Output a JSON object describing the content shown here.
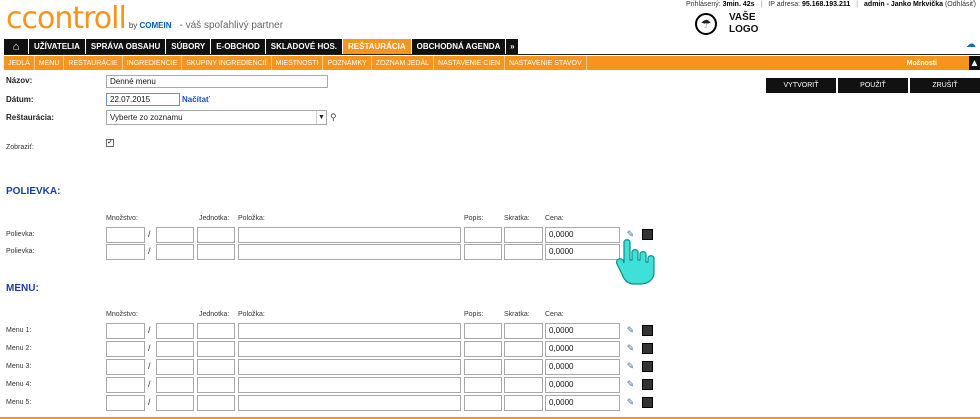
{
  "header": {
    "logo_main": "ccontroll",
    "logo_by": "by",
    "logo_company": "COMEIN",
    "tagline": "- váš spoľahlivý partner",
    "login_label": "Prihlásený:",
    "login_time": "3min. 42s",
    "ip_label": "IP adresa:",
    "ip_value": "95.168.193.211",
    "user": "admin - Janko Mrkvička",
    "logout": "(Odhlásiť)",
    "client_logo_line1": "VAŠE",
    "client_logo_line2": "LOGO"
  },
  "mainnav": {
    "items": [
      "UŽÍVATELIA",
      "SPRÁVA OBSAHU",
      "SÚBORY",
      "E-OBCHOD",
      "SKLADOVÉ HOS.",
      "REŠTAURÁCIA",
      "OBCHODNÁ AGENDA"
    ],
    "active_index": 5,
    "more": "»"
  },
  "subnav": {
    "items": [
      "Jedlá",
      "Menu",
      "Reštaurácie",
      "Ingrediencie",
      "Skupiny ingrediencií",
      "Miestnosti",
      "Poznámky",
      "Zoznam jedál",
      "Nastavenie cien",
      "Nastavenie stavov"
    ],
    "options": "Možnosti"
  },
  "actions": {
    "create": "VYTVORIŤ",
    "use": "POUŽIŤ",
    "cancel": "ZRUŠIŤ"
  },
  "form": {
    "name_label": "Názov:",
    "name_value": "Denné menu",
    "date_label": "Dátum:",
    "date_value": "22.07.2015",
    "load_label": "Načítať",
    "restaurant_label": "Reštaurácia:",
    "restaurant_value": "Vyberte zo zoznamu",
    "show_label": "Zobraziť:",
    "show_checked": true
  },
  "columns": {
    "quantity": "Množstvo:",
    "unit": "Jednotka:",
    "item": "Položka:",
    "description": "Popis:",
    "short": "Skratka:",
    "price": "Cena:"
  },
  "soup": {
    "title": "POLIEVKA:",
    "rows": [
      {
        "label": "Polievka:",
        "price": "0,0000"
      },
      {
        "label": "Polievka:",
        "price": "0,0000"
      }
    ]
  },
  "menu": {
    "title": "MENU:",
    "rows": [
      {
        "label": "Menu 1:",
        "price": "0,0000"
      },
      {
        "label": "Menu 2:",
        "price": "0,0000"
      },
      {
        "label": "Menu 3:",
        "price": "0,0000"
      },
      {
        "label": "Menu 4:",
        "price": "0,0000"
      },
      {
        "label": "Menu 5:",
        "price": "0,0000"
      }
    ]
  },
  "separator": "/",
  "colors": {
    "accent": "#f7941d",
    "nav_dark": "#111111",
    "section_blue": "#1a3ca8"
  },
  "icons": {
    "home": "home-icon",
    "edit": "edit-icon",
    "delete": "delete-icon",
    "search": "search-icon",
    "cursor": "hand-cursor-icon"
  }
}
